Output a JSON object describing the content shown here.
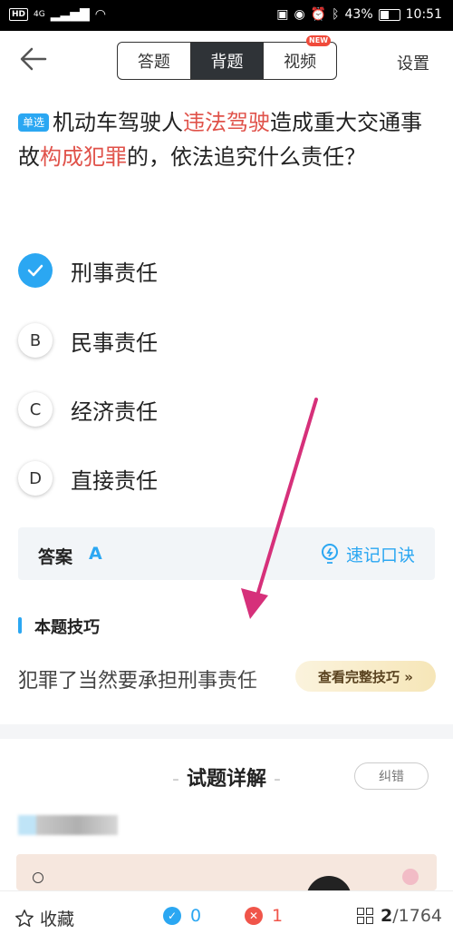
{
  "status_bar": {
    "hd": "HD",
    "signal": "4G",
    "battery": "43%",
    "time": "10:51"
  },
  "header": {
    "tabs": [
      {
        "label": "答题"
      },
      {
        "label": "背题"
      },
      {
        "label": "视频",
        "badge": "NEW"
      }
    ],
    "settings_label": "设置"
  },
  "question": {
    "type_badge": "单选",
    "parts": [
      {
        "text": "机动车驾驶人"
      },
      {
        "text": "违法驾驶",
        "highlight": true
      },
      {
        "text": "造成重大交通事故"
      },
      {
        "text": "构成犯罪",
        "highlight": true
      },
      {
        "text": "的，依法追究什么责任？"
      }
    ]
  },
  "options": [
    {
      "letter": "A",
      "text": "刑事责任",
      "correct": true
    },
    {
      "letter": "B",
      "text": "民事责任"
    },
    {
      "letter": "C",
      "text": "经济责任"
    },
    {
      "letter": "D",
      "text": "直接责任"
    }
  ],
  "answer": {
    "label": "答案",
    "value": "A",
    "memo_label": "速记口诀"
  },
  "skill": {
    "title": "本题技巧",
    "text": "犯罪了当然要承担刑事责任",
    "button": "查看完整技巧 »"
  },
  "explanation": {
    "title": "试题详解",
    "correct_button": "纠错"
  },
  "bottom": {
    "favorite_label": "收藏",
    "correct_count": "0",
    "wrong_count": "1",
    "progress_current": "2",
    "progress_total": "/1764"
  },
  "colors": {
    "accent": "#2ba7f2",
    "highlight": "#e0524a",
    "arrow": "#d6307a"
  }
}
